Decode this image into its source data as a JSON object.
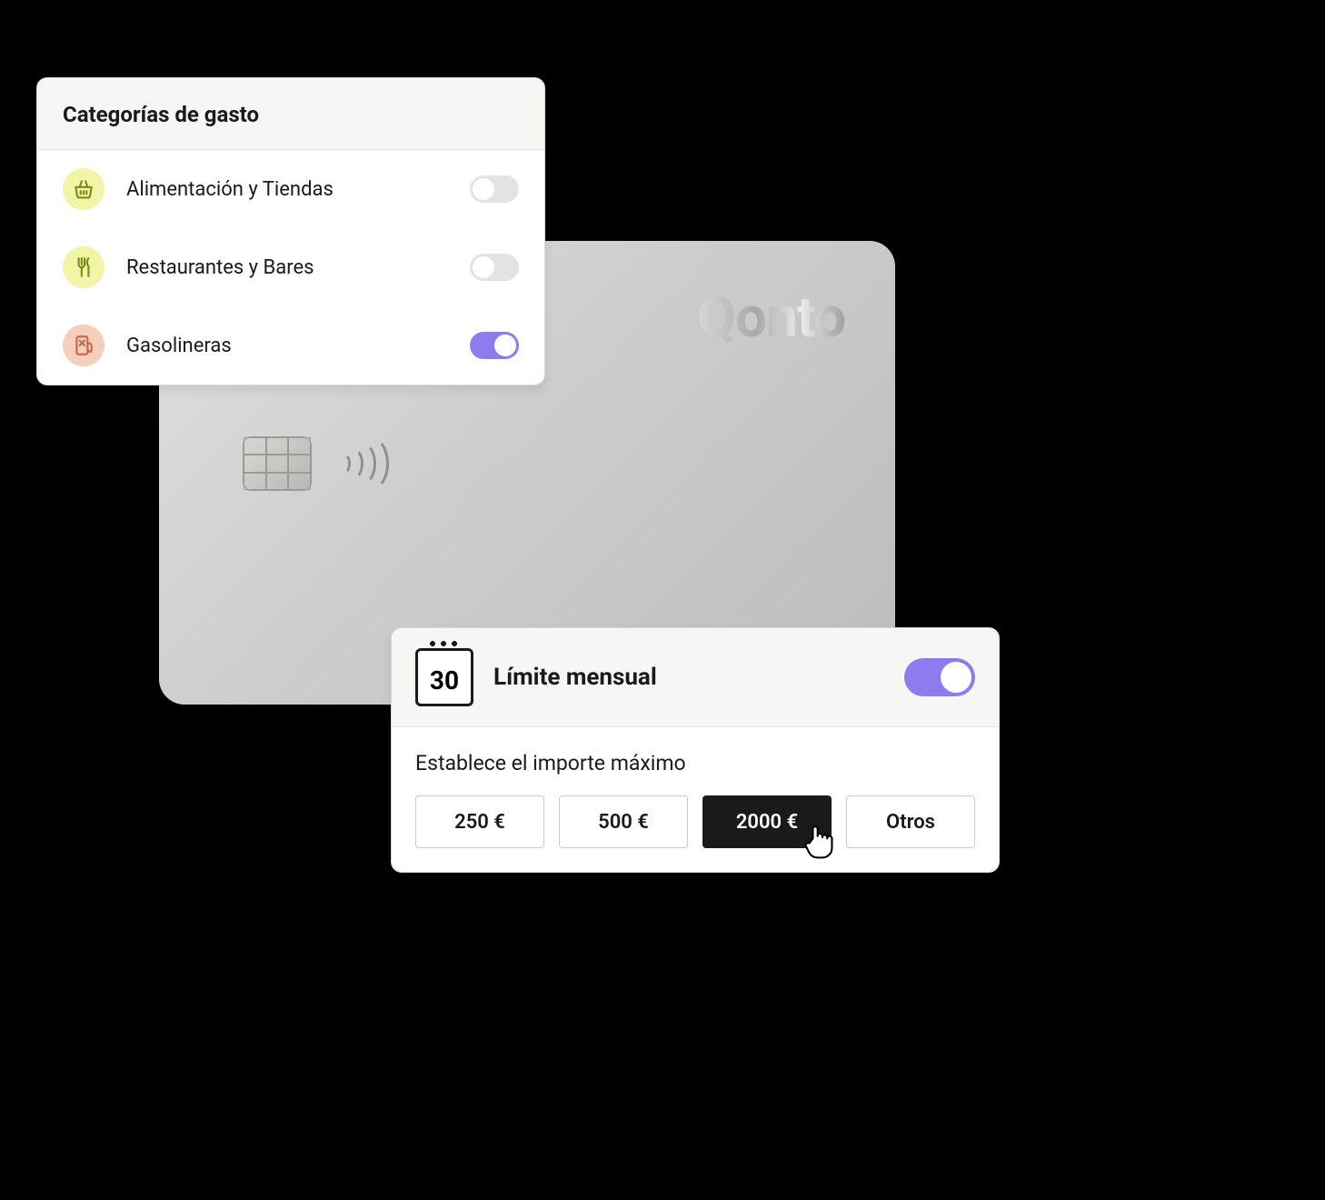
{
  "brand": "Qonto",
  "categories": {
    "title": "Categorías de gasto",
    "items": [
      {
        "icon": "basket",
        "icon_name": "basket-icon",
        "bg": "#f2f4a6",
        "stroke": "#7b8c1a",
        "label": "Alimentación y Tiendas",
        "on": false
      },
      {
        "icon": "fork",
        "icon_name": "fork-knife-icon",
        "bg": "#f2f4a6",
        "stroke": "#7b8c1a",
        "label": "Restaurantes y Bares",
        "on": false
      },
      {
        "icon": "fuel",
        "icon_name": "fuel-icon",
        "bg": "#f7cdbb",
        "stroke": "#c46a4d",
        "label": "Gasolineras",
        "on": true
      }
    ]
  },
  "limit": {
    "calendar_day": "30",
    "title": "Límite mensual",
    "enabled": true,
    "instruction": "Establece el importe máximo",
    "options": [
      {
        "label": "250 €",
        "selected": false
      },
      {
        "label": "500 €",
        "selected": false
      },
      {
        "label": "2000 €",
        "selected": true
      },
      {
        "label": "Otros",
        "selected": false
      }
    ]
  },
  "colors": {
    "accent": "#8c7cf0",
    "text": "#1a1a1a"
  }
}
